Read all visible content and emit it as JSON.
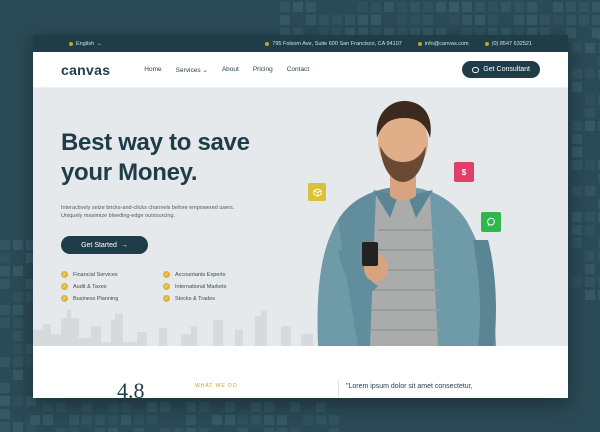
{
  "topbar": {
    "language": "English",
    "address": "795 Folsom Ave, Suite 600 San Francisco, CA 94107",
    "email": "info@canvas.com",
    "phone": "(0) 8547 632521"
  },
  "nav": {
    "logo": "canvas",
    "items": [
      "Home",
      "Services",
      "About",
      "Pricing",
      "Contact"
    ],
    "cta": "Get Consultant"
  },
  "hero": {
    "title_line1": "Best way to save",
    "title_line2": "your Money.",
    "description": "Interactively seize bricks-and-clicks channels before empowered users. Uniquely maximize bleeding-edge outsourcing.",
    "cta": "Get Started",
    "features": [
      "Financial Services",
      "Accountants Experts",
      "Audit & Taxes",
      "International Markets",
      "Business Planning",
      "Stocks & Trades"
    ]
  },
  "bottom": {
    "number": "4.8",
    "kicker": "WHAT WE DO",
    "quote": "\"Lorem ipsum dolor sit amet consectetur,"
  },
  "colors": {
    "primary": "#1f3d48",
    "accent": "#e0b33a",
    "background": "#2a4a55",
    "icon_pink": "#e0406a",
    "icon_green": "#2fb84a",
    "icon_yellow": "#d9c23a"
  },
  "icons": {
    "dollar": "$",
    "chat": "chat-bubble-icon",
    "box": "box-icon"
  }
}
